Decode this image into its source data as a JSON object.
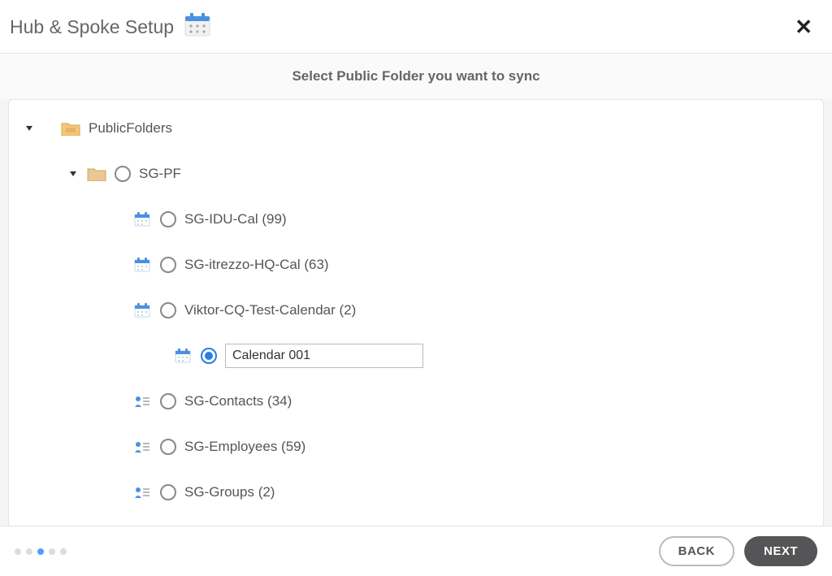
{
  "header": {
    "title": "Hub & Spoke Setup"
  },
  "subtitle": "Select Public Folder you want to sync",
  "tree": {
    "root_label": "PublicFolders",
    "level1_label": "SG-PF",
    "items": [
      {
        "label": "SG-IDU-Cal (99)"
      },
      {
        "label": "SG-itrezzo-HQ-Cal (63)"
      },
      {
        "label": "Viktor-CQ-Test-Calendar (2)"
      },
      {
        "label": "SG-Contacts (34)"
      },
      {
        "label": "SG-Employees (59)"
      },
      {
        "label": "SG-Groups (2)"
      }
    ],
    "edit_value": "Calendar 001"
  },
  "footer": {
    "back_label": "BACK",
    "next_label": "NEXT"
  },
  "progress": {
    "total": 5,
    "current_index": 2
  }
}
